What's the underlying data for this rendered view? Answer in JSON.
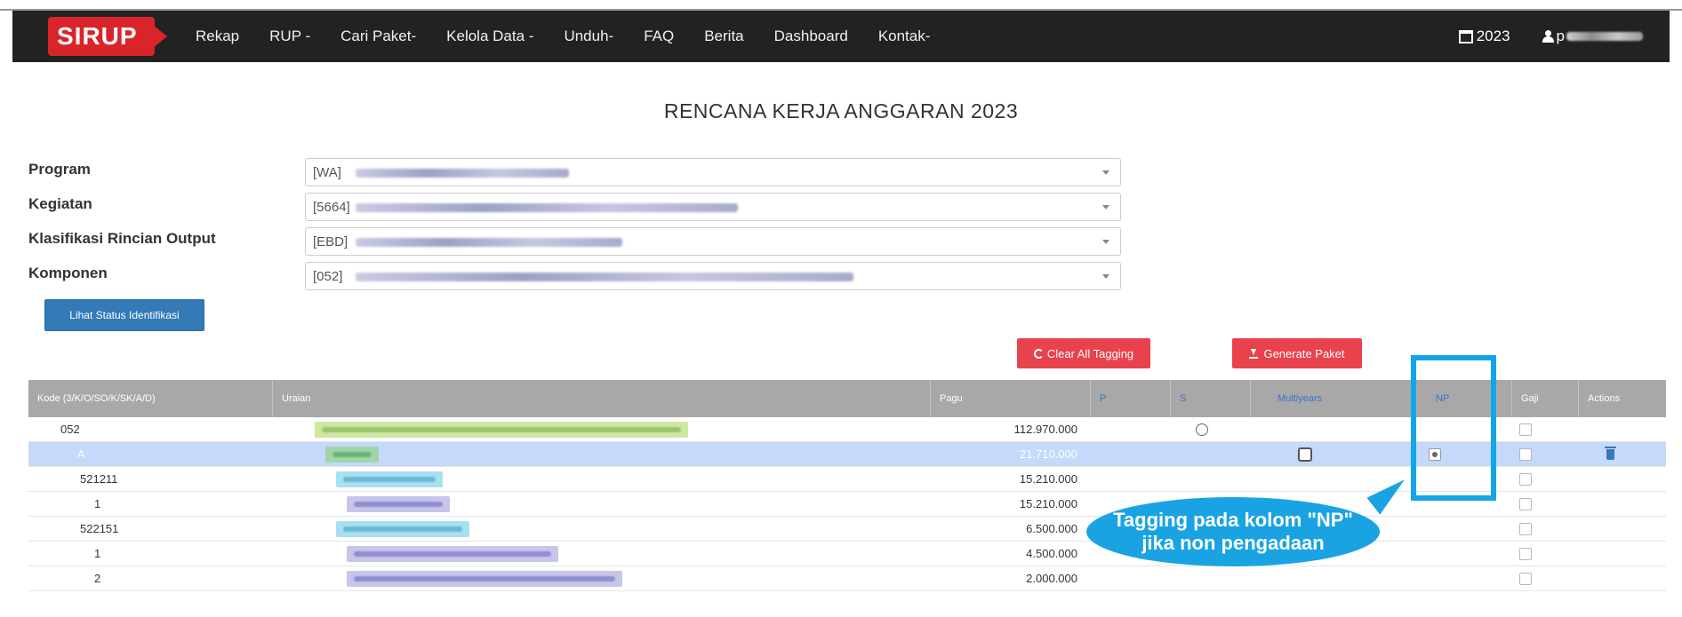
{
  "navbar": {
    "brand": "SIRUP",
    "items": [
      "Rekap",
      "RUP -",
      "Cari Paket-",
      "Kelola Data -",
      "Unduh-",
      "FAQ",
      "Berita",
      "Dashboard",
      "Kontak-"
    ],
    "year": "2023",
    "user": "p",
    "icons": {
      "year": "calendar-icon",
      "user": "user-icon"
    }
  },
  "page_title": "RENCANA KERJA ANGGARAN 2023",
  "form": {
    "program": {
      "label": "Program",
      "code": "[WA]"
    },
    "kegiatan": {
      "label": "Kegiatan",
      "code": "[5664]"
    },
    "kro": {
      "label": "Klasifikasi Rincian Output",
      "code": "[EBD]"
    },
    "komponen": {
      "label": "Komponen",
      "code": "[052]"
    }
  },
  "buttons": {
    "lihat_status": "Lihat Status Identifikasi",
    "clear_tagging": "Clear All Tagging",
    "generate_paket": "Generate Paket"
  },
  "table": {
    "headers": [
      "Kode (3/K/O/SO/K/SK/A/D)",
      "Uraian",
      "Pagu",
      "P",
      "S",
      "Multiyears",
      "NP",
      "Gaji",
      "Actions"
    ],
    "rows": [
      {
        "kode": "052",
        "pagu": "112.970.000"
      },
      {
        "kode": "A",
        "pagu": "21.710.000"
      },
      {
        "kode": "521211",
        "pagu": "15.210.000"
      },
      {
        "kode": "1",
        "pagu": "15.210.000"
      },
      {
        "kode": "522151",
        "pagu": "6.500.000"
      },
      {
        "kode": "1",
        "pagu": "4.500.000"
      },
      {
        "kode": "2",
        "pagu": "2.000.000"
      }
    ]
  },
  "annotation": {
    "line1": "Tagging pada kolom \"NP\"",
    "line2": "jika non pengadaan",
    "color": "#1aa3e3"
  },
  "colors": {
    "navbar": "#222222",
    "brand": "#d9242a",
    "primary_button": "#337ab7",
    "danger_button": "#e8424c",
    "table_header": "#a8a8a8",
    "row_highlight": "#c5d9fb"
  }
}
